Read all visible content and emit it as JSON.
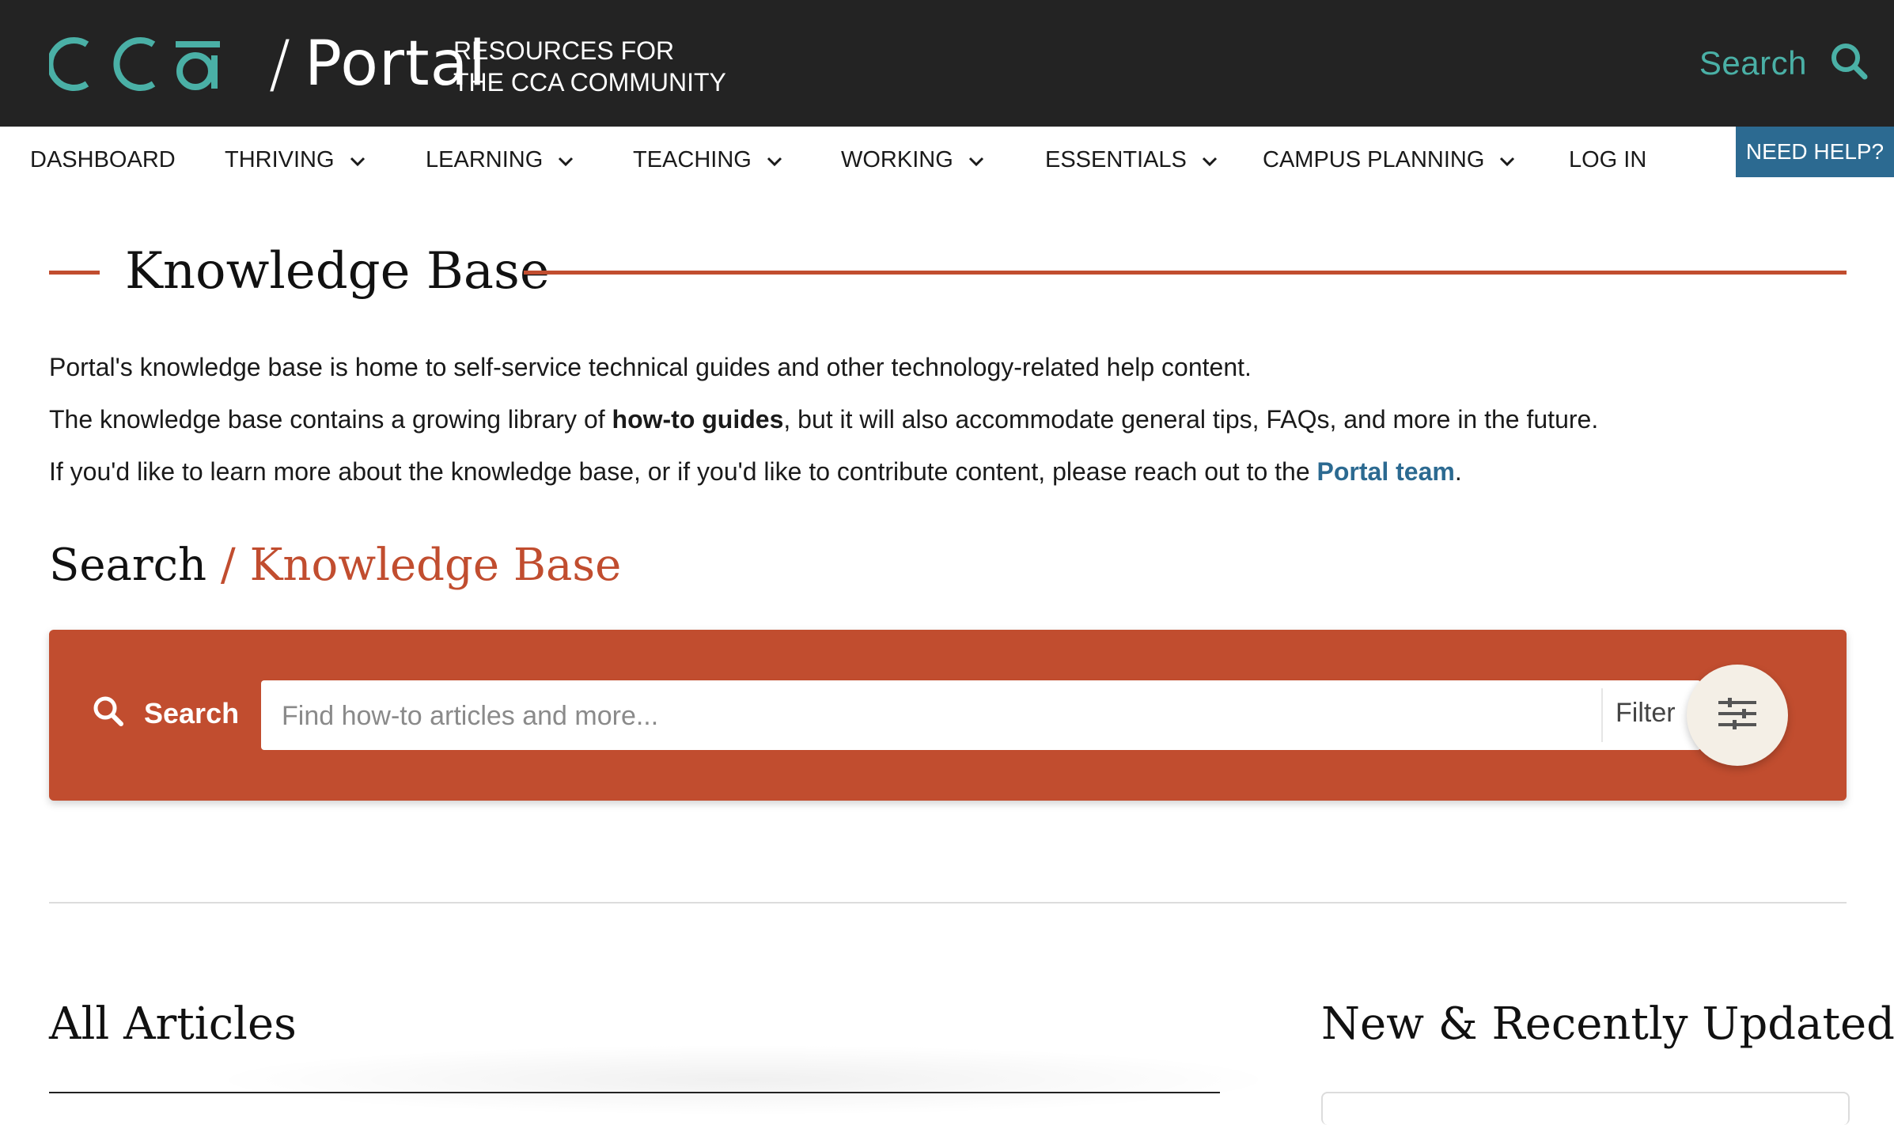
{
  "header": {
    "logo_text": "CCA",
    "logo_separator": "/",
    "logo_product": "Portal",
    "tagline_line1": "Resources for",
    "tagline_line2": "the CCA Community",
    "search_label": "Search"
  },
  "nav": {
    "items": [
      {
        "label": "Dashboard"
      },
      {
        "label": "Thriving"
      },
      {
        "label": "Learning"
      },
      {
        "label": "Teaching"
      },
      {
        "label": "Working"
      },
      {
        "label": "Essentials"
      },
      {
        "label": "Campus Planning"
      },
      {
        "label": "Log In"
      }
    ],
    "help_label": "Need help?"
  },
  "main": {
    "title": "Knowledge Base",
    "intro": {
      "p1": "Portal's knowledge base is home to self-service technical guides and other technology-related help content.",
      "p2_before": "The knowledge base contains a growing library of ",
      "p2_bold": "how-to guides",
      "p2_after": ", but it will also accommodate general tips, FAQs, and more in the future.",
      "p3_before": "If you'd like to learn more about the knowledge base, or if you'd like to contribute content, please reach out to the ",
      "p3_link": "Portal team",
      "p3_after": "."
    },
    "search_heading_a": "Search",
    "search_heading_b": "/ Knowledge Base",
    "search_panel": {
      "label": "Search",
      "placeholder": "Find how-to articles and more...",
      "value": "",
      "filter_label": "Filter"
    },
    "all_articles_heading": "All Articles",
    "new_updated_heading": "New & Recently Updated"
  },
  "colors": {
    "header_bg": "#232323",
    "teal_accent": "#4ab0a6",
    "orange_accent": "#c14d2f",
    "help_blue": "#2c6a91",
    "filter_button_bg": "#f4efe6"
  },
  "icons": [
    "search-icon",
    "chevron-down-icon",
    "sliders-icon"
  ]
}
